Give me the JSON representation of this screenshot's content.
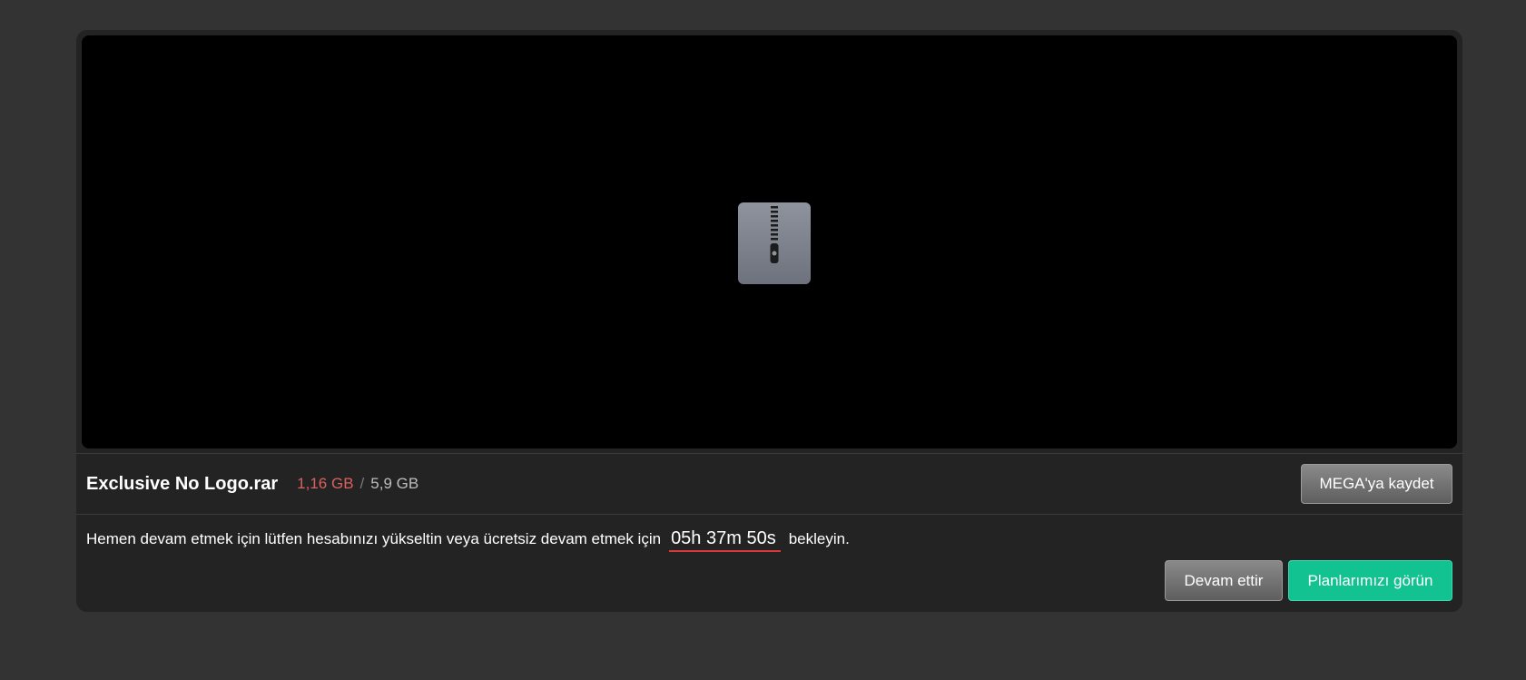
{
  "file": {
    "name": "Exclusive No Logo.rar",
    "downloaded": "1,16 GB",
    "separator": "/",
    "total": "5,9 GB"
  },
  "preview": {
    "icon": "zip-archive-icon"
  },
  "actions": {
    "save_label": "MEGA'ya kaydet",
    "continue_label": "Devam ettir",
    "plans_label": "Planlarımızı görün"
  },
  "message": {
    "before": "Hemen devam etmek için lütfen hesabınızı yükseltin veya ücretsiz devam etmek için",
    "timer": "05h 37m 50s",
    "after": "bekleyin."
  },
  "colors": {
    "page_bg": "#333333",
    "card_bg": "#232323",
    "downloaded": "#d9615f",
    "timer_underline": "#d9393b",
    "primary": "#12c290"
  }
}
